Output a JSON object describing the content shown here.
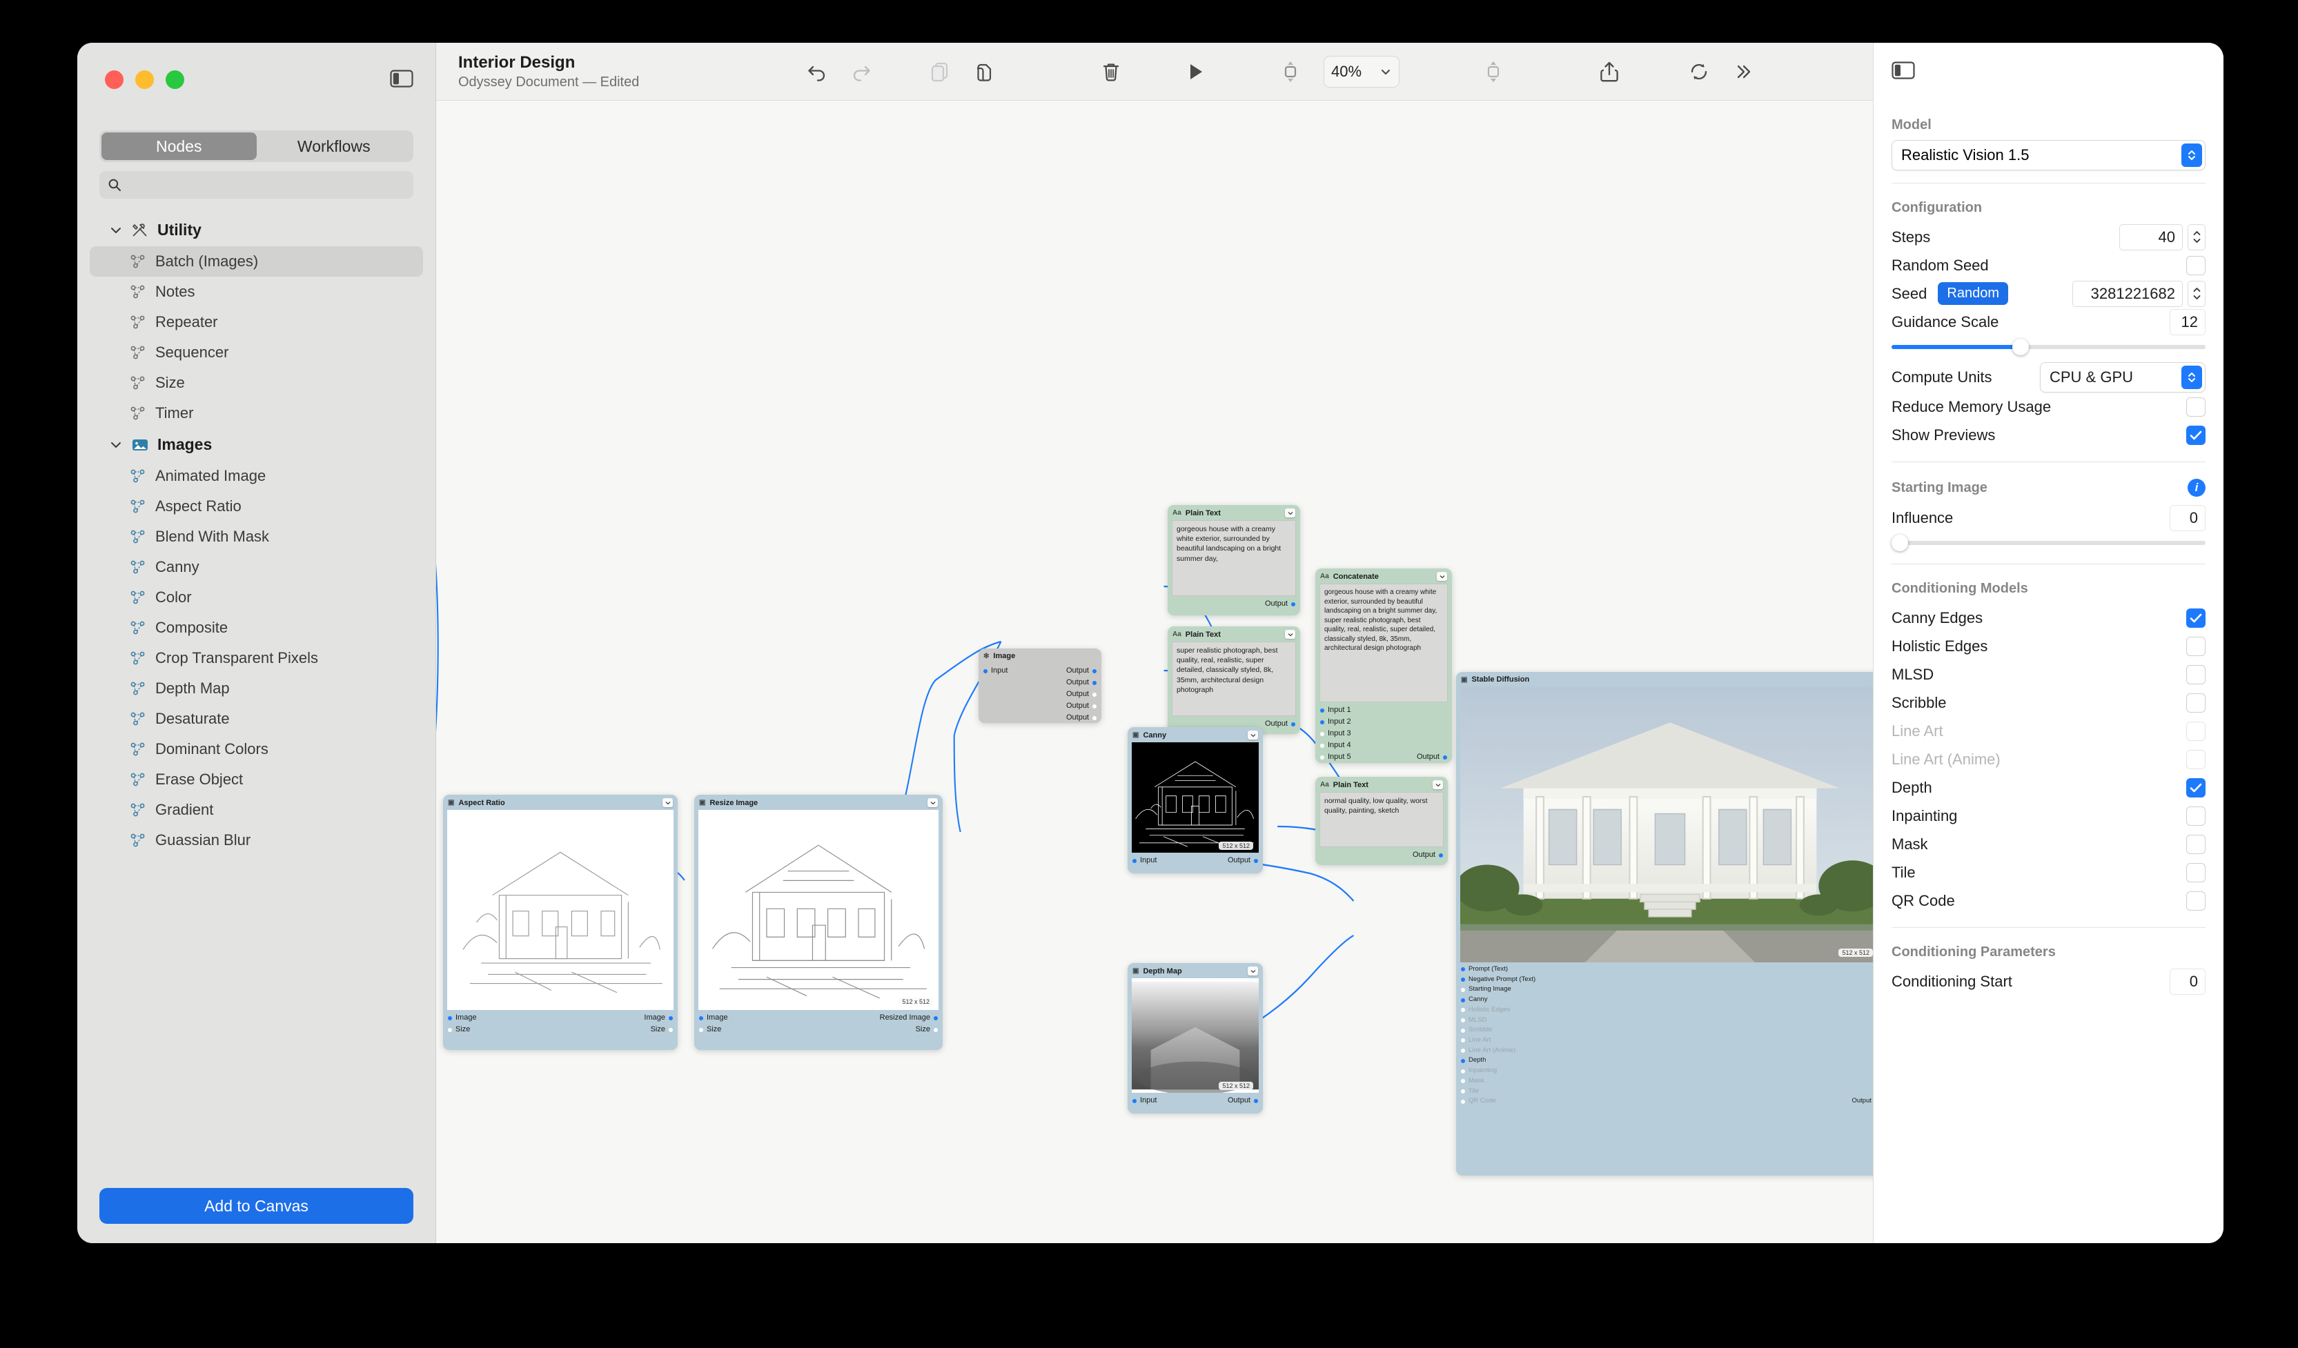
{
  "window": {
    "title": "Interior Design",
    "subtitle": "Odyssey Document — Edited"
  },
  "sidebar": {
    "tabs": [
      {
        "label": "Nodes",
        "active": true
      },
      {
        "label": "Workflows",
        "active": false
      }
    ],
    "search_placeholder": "",
    "search_value": "",
    "groups": [
      {
        "name": "Utility",
        "icon": "tools-icon",
        "items": [
          {
            "label": "Batch (Images)",
            "selected": true
          },
          {
            "label": "Notes",
            "selected": false
          },
          {
            "label": "Repeater",
            "selected": false
          },
          {
            "label": "Sequencer",
            "selected": false
          },
          {
            "label": "Size",
            "selected": false
          },
          {
            "label": "Timer",
            "selected": false
          }
        ]
      },
      {
        "name": "Images",
        "icon": "photo-icon",
        "items": [
          {
            "label": "Animated Image",
            "selected": false
          },
          {
            "label": "Aspect Ratio",
            "selected": false
          },
          {
            "label": "Blend With Mask",
            "selected": false
          },
          {
            "label": "Canny",
            "selected": false
          },
          {
            "label": "Color",
            "selected": false
          },
          {
            "label": "Composite",
            "selected": false
          },
          {
            "label": "Crop Transparent Pixels",
            "selected": false
          },
          {
            "label": "Depth Map",
            "selected": false
          },
          {
            "label": "Desaturate",
            "selected": false
          },
          {
            "label": "Dominant Colors",
            "selected": false
          },
          {
            "label": "Erase Object",
            "selected": false
          },
          {
            "label": "Gradient",
            "selected": false
          },
          {
            "label": "Guassian Blur",
            "selected": false
          }
        ]
      }
    ],
    "add_button": "Add to Canvas"
  },
  "toolbar": {
    "undo": "undo-icon",
    "redo": "redo-icon",
    "copy": "copy-icon",
    "paste": "paste-icon",
    "delete": "trash-icon",
    "run": "play-icon",
    "fit_left": "fit-vertical-icon",
    "zoom_value": "40%",
    "fit_right": "fit-vertical-icon",
    "share": "share-icon",
    "sync": "refresh-icon",
    "more": "chevrons-right-icon",
    "panel_toggle": "sidebar-toggle-icon"
  },
  "inspector": {
    "panel_toggle": "sidebar-toggle-icon",
    "model": {
      "label": "Model",
      "value": "Realistic Vision 1.5"
    },
    "configuration": {
      "label": "Configuration",
      "steps": {
        "label": "Steps",
        "value": "40"
      },
      "random_seed": {
        "label": "Random Seed",
        "checked": false
      },
      "seed": {
        "label": "Seed",
        "random_label": "Random",
        "value": "3281221682"
      },
      "guidance_scale": {
        "label": "Guidance Scale",
        "value": "12",
        "percent": 41
      },
      "compute_units": {
        "label": "Compute Units",
        "value": "CPU & GPU"
      },
      "reduce_memory": {
        "label": "Reduce Memory Usage",
        "checked": false
      },
      "show_previews": {
        "label": "Show Previews",
        "checked": true
      }
    },
    "starting_image": {
      "label": "Starting Image",
      "influence": {
        "label": "Influence",
        "value": "0",
        "percent": 0
      }
    },
    "conditioning_models": {
      "label": "Conditioning Models",
      "items": [
        {
          "label": "Canny Edges",
          "checked": true,
          "disabled": false
        },
        {
          "label": "Holistic Edges",
          "checked": false,
          "disabled": false
        },
        {
          "label": "MLSD",
          "checked": false,
          "disabled": false
        },
        {
          "label": "Scribble",
          "checked": false,
          "disabled": false
        },
        {
          "label": "Line Art",
          "checked": false,
          "disabled": true
        },
        {
          "label": "Line Art (Anime)",
          "checked": false,
          "disabled": true
        },
        {
          "label": "Depth",
          "checked": true,
          "disabled": false
        },
        {
          "label": "Inpainting",
          "checked": false,
          "disabled": false
        },
        {
          "label": "Mask",
          "checked": false,
          "disabled": false
        },
        {
          "label": "Tile",
          "checked": false,
          "disabled": false
        },
        {
          "label": "QR Code",
          "checked": false,
          "disabled": false
        }
      ]
    },
    "conditioning_parameters": {
      "label": "Conditioning Parameters",
      "start": {
        "label": "Conditioning Start",
        "value": "0"
      }
    }
  },
  "canvas": {
    "nodes": {
      "aspect_ratio": {
        "title": "Aspect Ratio",
        "inputs": [
          "Image",
          "Size"
        ],
        "outputs": [
          "Image",
          "Size"
        ]
      },
      "resize_image": {
        "title": "Resize Image",
        "inputs": [
          "Image",
          "Size"
        ],
        "outputs": [
          "Resized Image",
          "Size"
        ],
        "badge": "512 x 512"
      },
      "batch_images": {
        "title": "Image",
        "inputs": [
          "Input"
        ],
        "outputs": [
          "Output",
          "Output",
          "Output",
          "Output",
          "Output"
        ]
      },
      "prompt_positive": {
        "title": "Plain Text",
        "text": "gorgeous house with a creamy white exterior, surrounded by beautiful landscaping on a bright summer day,",
        "output": "Output"
      },
      "prompt_style": {
        "title": "Plain Text",
        "text": "super realistic photograph, best quality, real, realistic, super detailed, classically styled, 8k, 35mm, architectural design photograph",
        "output": "Output"
      },
      "concatenate": {
        "title": "Concatenate",
        "text": "gorgeous house with a creamy white exterior, surrounded by beautiful landscaping on a bright summer day, super realistic photograph, best quality, real, realistic, super detailed, classically styled, 8k, 35mm, architectural design photograph",
        "inputs": [
          "Input 1",
          "Input 2",
          "Input 3",
          "Input 4",
          "Input 5"
        ],
        "output": "Output"
      },
      "prompt_negative": {
        "title": "Plain Text",
        "text": "normal quality, low quality, worst quality, painting, sketch",
        "output": "Output"
      },
      "canny": {
        "title": "Canny",
        "inputs": [
          "Input"
        ],
        "outputs": [
          "Output"
        ],
        "badge": "512 x 512"
      },
      "depth_map": {
        "title": "Depth Map",
        "inputs": [
          "Input"
        ],
        "outputs": [
          "Output"
        ],
        "badge": "512 x 512"
      },
      "stable_diffusion": {
        "title": "Stable Diffusion",
        "badge": "512 x 512",
        "inputs": [
          {
            "label": "Prompt (Text)",
            "connected": true
          },
          {
            "label": "Negative Prompt (Text)",
            "connected": true
          },
          {
            "label": "Starting Image",
            "connected": false
          },
          {
            "label": "Canny",
            "connected": true
          },
          {
            "label": "Holistic Edges",
            "connected": false
          },
          {
            "label": "MLSD",
            "connected": false
          },
          {
            "label": "Scribble",
            "connected": false
          },
          {
            "label": "Line Art",
            "connected": false
          },
          {
            "label": "Line Art (Anime)",
            "connected": false
          },
          {
            "label": "Depth",
            "connected": true
          },
          {
            "label": "Inpainting",
            "connected": false
          },
          {
            "label": "Mask",
            "connected": false
          },
          {
            "label": "Tile",
            "connected": false
          },
          {
            "label": "QR Code",
            "connected": false
          }
        ],
        "output": "Output"
      }
    }
  },
  "colors": {
    "accent": "#1d7afc",
    "add_button": "#1d6fe8",
    "image_node": "#b7cdd9",
    "text_node": "#bcd6c3",
    "wire": "#1d7afc"
  }
}
